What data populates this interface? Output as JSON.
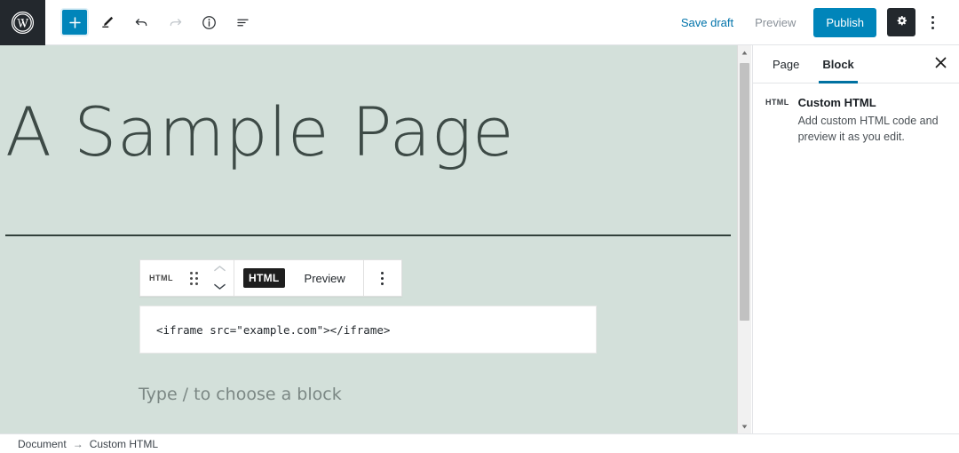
{
  "topbar": {
    "logo_icon": "wordpress-logo-icon",
    "left_tools": [
      {
        "name": "add-block-button",
        "icon": "plus-icon",
        "label": "Add block",
        "state": "primary"
      },
      {
        "name": "edit-tool-button",
        "icon": "pencil-icon",
        "label": "Edit",
        "state": "default"
      },
      {
        "name": "undo-button",
        "icon": "undo-arrow-icon",
        "label": "Undo",
        "state": "default"
      },
      {
        "name": "redo-button",
        "icon": "redo-arrow-icon",
        "label": "Redo",
        "state": "disabled"
      },
      {
        "name": "content-info-button",
        "icon": "info-circle-icon",
        "label": "Content structure",
        "state": "default"
      },
      {
        "name": "list-view-button",
        "icon": "list-view-icon",
        "label": "List view",
        "state": "default"
      }
    ],
    "save_draft_label": "Save draft",
    "preview_label": "Preview",
    "publish_label": "Publish",
    "settings_icon": "gear-icon",
    "more_menu_icon": "kebab-menu-icon"
  },
  "canvas": {
    "post_title": "A Sample Page",
    "separator": "horizontal-rule",
    "block_toolbar": {
      "block_type_label": "HTML",
      "drag_handle_icon": "drag-handle-icon",
      "move_up_icon": "chevron-up-icon",
      "move_down_icon": "chevron-down-icon",
      "html_tab_label": "HTML",
      "preview_tab_label": "Preview",
      "active_tab": "HTML",
      "options_icon": "kebab-menu-icon"
    },
    "code_value": "<iframe src=\"example.com\"></iframe>",
    "appender_placeholder": "Type / to choose a block",
    "background_color": "#d3e0da"
  },
  "scrollbar": {
    "up_arrow_icon": "scroll-up-arrow-icon",
    "down_arrow_icon": "scroll-down-arrow-icon",
    "thumb": "scrollbar-thumb"
  },
  "sidebar": {
    "tabs": [
      {
        "label": "Page",
        "active": false
      },
      {
        "label": "Block",
        "active": true
      }
    ],
    "close_icon": "close-icon",
    "block_icon_label": "HTML",
    "block_title": "Custom HTML",
    "block_description": "Add custom HTML code and preview it as you edit.",
    "accent_color": "#0071a1"
  },
  "footer": {
    "breadcrumb": [
      {
        "label": "Document"
      },
      {
        "label": "Custom HTML"
      }
    ],
    "separator": "→"
  }
}
